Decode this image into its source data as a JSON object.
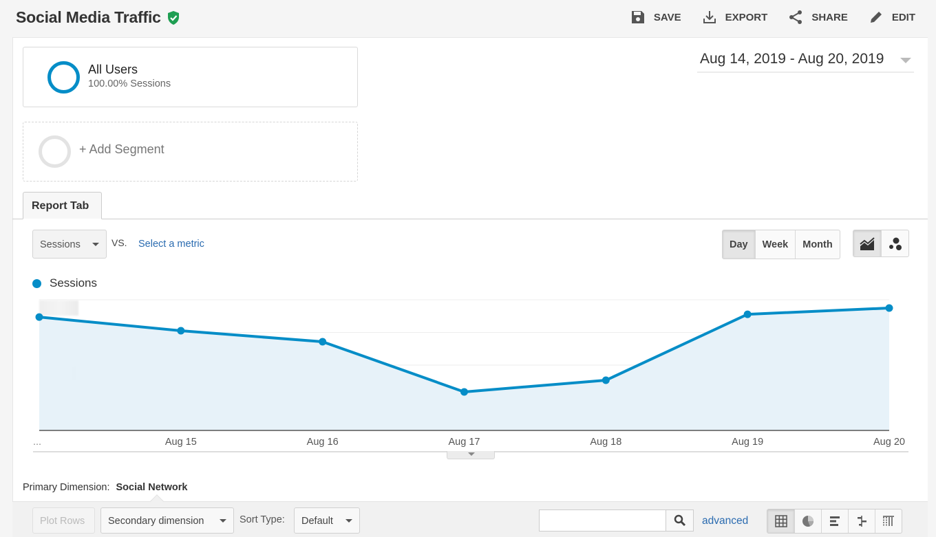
{
  "header": {
    "title": "Social Media Traffic",
    "verified_icon": "shield-check-icon",
    "verified_color": "#1e9e52",
    "actions": [
      {
        "label": "SAVE",
        "icon": "save-icon"
      },
      {
        "label": "EXPORT",
        "icon": "download-icon"
      },
      {
        "label": "SHARE",
        "icon": "share-icon"
      },
      {
        "label": "EDIT",
        "icon": "pencil-icon"
      }
    ]
  },
  "segments": {
    "active": {
      "name": "All Users",
      "subtitle": "100.00% Sessions",
      "color": "#058dc7"
    },
    "add_label": "+ Add Segment"
  },
  "date_range": {
    "label": "Aug 14, 2019 - Aug 20, 2019"
  },
  "tabs": [
    {
      "label": "Report Tab",
      "active": true
    }
  ],
  "metric_controls": {
    "metric": "Sessions",
    "vs_label": "VS.",
    "compare_link": "Select a metric",
    "periods": [
      "Day",
      "Week",
      "Month"
    ],
    "active_period": "Day",
    "chart_types": [
      {
        "icon": "line-chart-icon",
        "active": true
      },
      {
        "icon": "motion-chart-icon",
        "active": false
      }
    ]
  },
  "chart_data": {
    "type": "area",
    "title": "",
    "legend": [
      {
        "name": "Sessions",
        "color": "#058dc7"
      }
    ],
    "legend_placement": "top-left",
    "categories": [
      "Aug 14",
      "Aug 15",
      "Aug 16",
      "Aug 17",
      "Aug 18",
      "Aug 19",
      "Aug 20"
    ],
    "x_tick_labels": [
      "...",
      "Aug 15",
      "Aug 16",
      "Aug 17",
      "Aug 18",
      "Aug 19",
      "Aug 20"
    ],
    "series": [
      {
        "name": "Sessions",
        "values": [
          86.8,
          76.3,
          67.9,
          29.5,
          38.4,
          88.9,
          93.7
        ],
        "color": "#058dc7",
        "fill": "#e6f1f9"
      }
    ],
    "value_units": "relative (% of top gridline; y-axis labels redacted in source)",
    "ylim": [
      0,
      100
    ],
    "y_gridlines": 4,
    "y_tick_labels": [
      "(redacted)",
      "(redacted)"
    ],
    "xlabel": "",
    "ylabel": "",
    "grid": true
  },
  "table_controls": {
    "primary_dimension_label": "Primary Dimension:",
    "primary_dimension_value": "Social Network",
    "plot_rows": "Plot Rows",
    "secondary_dimension": "Secondary dimension",
    "sort_type_label": "Sort Type:",
    "sort_type_value": "Default",
    "search_value": "",
    "search_icon": "search-icon",
    "advanced_link": "advanced",
    "view_modes": [
      {
        "icon": "table-grid-icon",
        "active": true
      },
      {
        "icon": "pie-chart-icon",
        "active": false
      },
      {
        "icon": "bar-performance-icon",
        "active": false
      },
      {
        "icon": "comparison-icon",
        "active": false
      },
      {
        "icon": "term-cloud-icon",
        "active": false
      }
    ]
  }
}
